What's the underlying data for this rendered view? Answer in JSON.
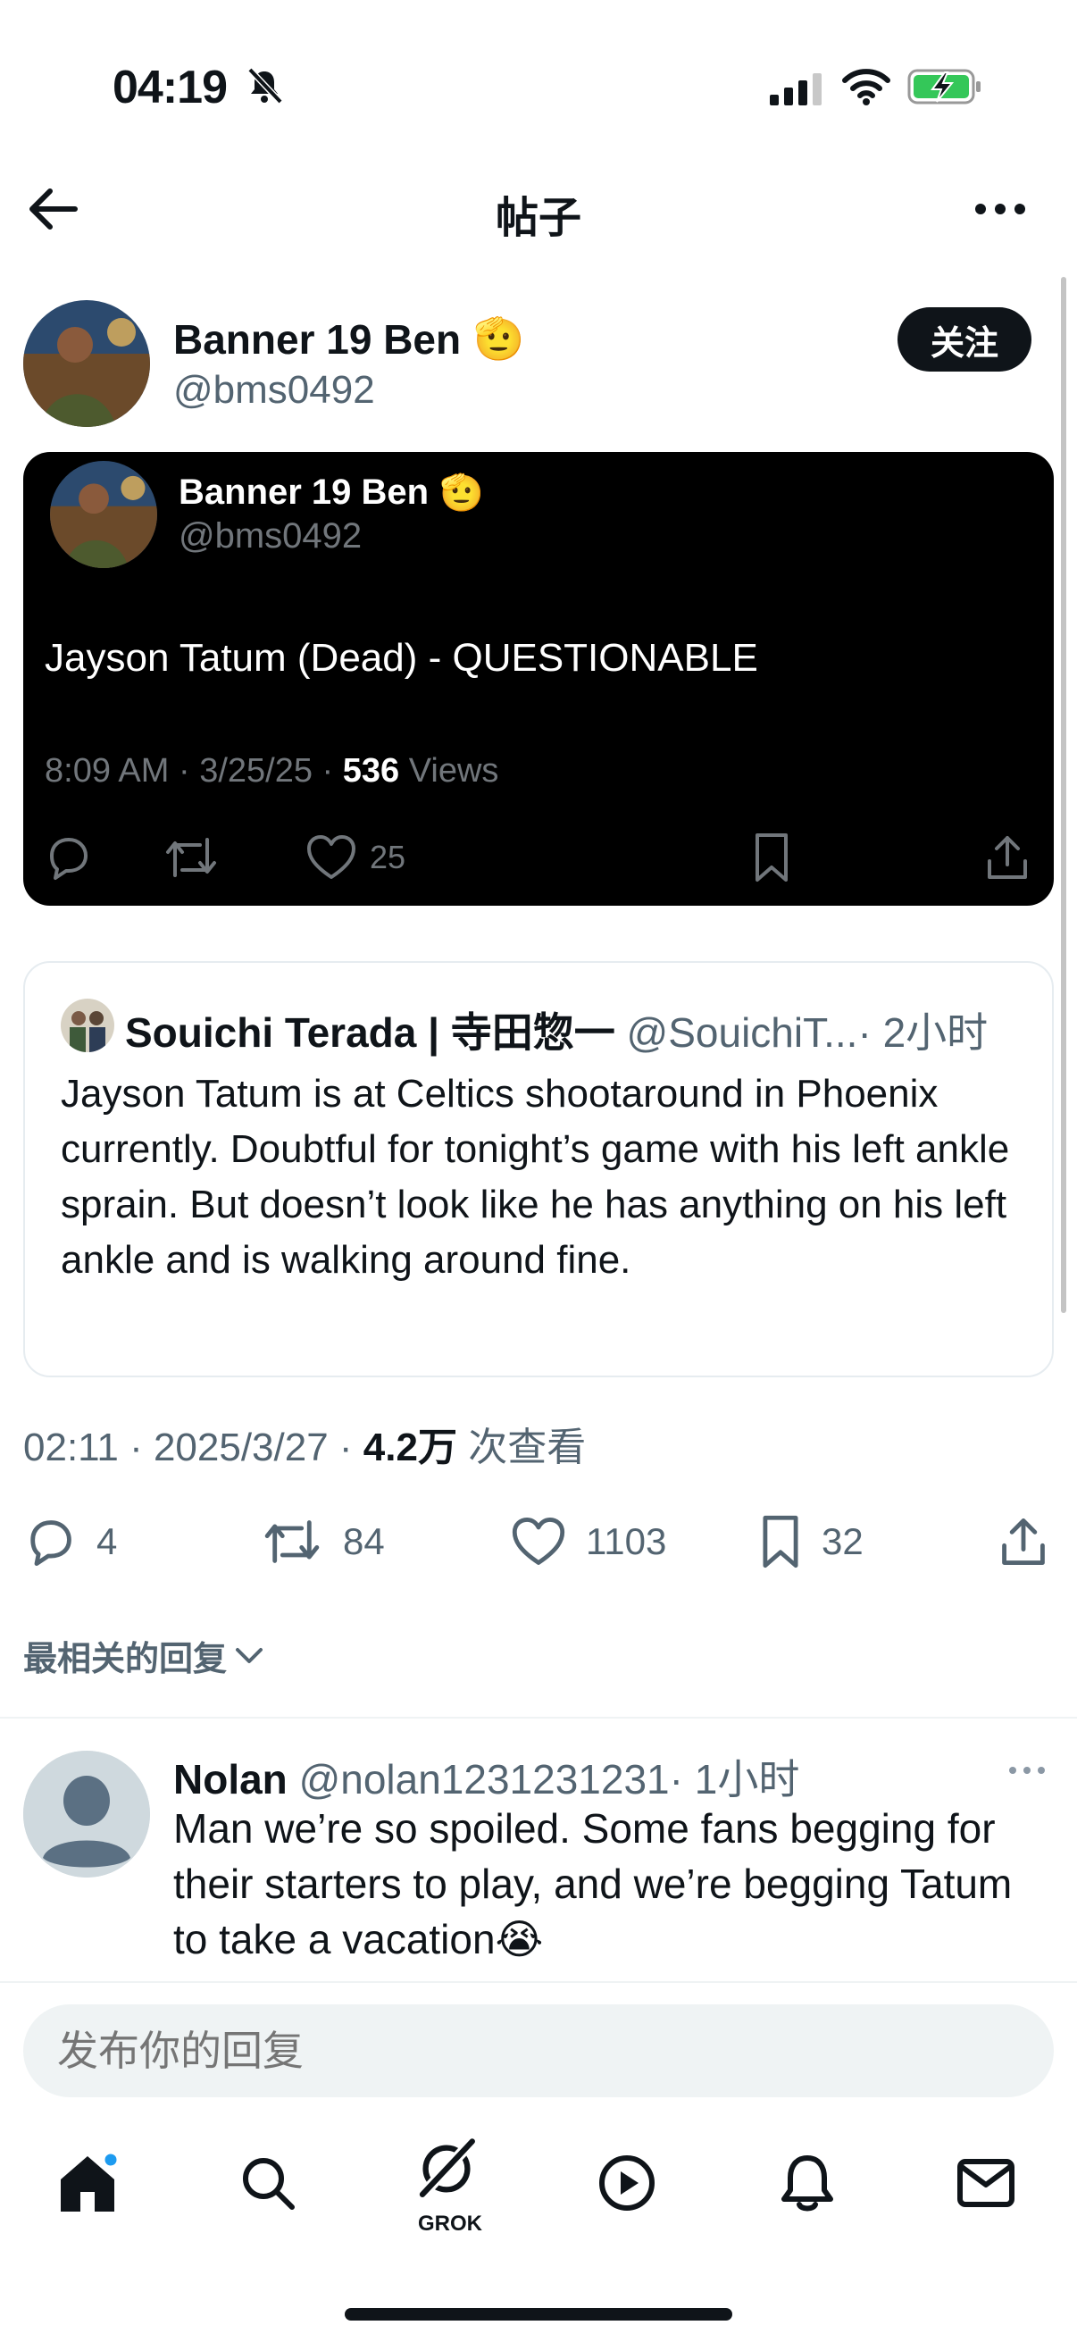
{
  "status_bar": {
    "time": "04:19"
  },
  "header": {
    "title": "帖子"
  },
  "post": {
    "author_name": "Banner 19 Ben",
    "author_handle": "@bms0492",
    "follow_label": "关注",
    "embedded": {
      "author_name": "Banner 19 Ben",
      "author_handle": "@bms0492",
      "text": "Jayson Tatum (Dead) - QUESTIONABLE",
      "time_date": "8:09 AM · 3/25/25 · ",
      "views_count": "536",
      "views_label": " Views",
      "likes": "25"
    },
    "quoted": {
      "author_name": "Souichi Terada | 寺田惣一",
      "author_handle": "@SouichiT...",
      "time": "· 2小时",
      "text": "Jayson Tatum is at Celtics shootaround in Phoenix currently. Doubtful for tonight’s game with his left ankle sprain. But doesn’t look like he has anything on his left ankle and is walking around fine."
    },
    "meta": {
      "time_date": "02:11 · 2025/3/27 · ",
      "views_count": "4.2万",
      "views_label": " 次查看"
    },
    "stats": {
      "replies": "4",
      "reposts": "84",
      "likes": "1103",
      "bookmarks": "32"
    }
  },
  "replies_sort": "最相关的回复",
  "reply": {
    "author_name": "Nolan",
    "author_handle": "@nolan1231231231",
    "time": "· 1小时",
    "text": "Man we’re so spoiled. Some fans begging for their starters to play, and we’re begging Tatum to take a vacation😭"
  },
  "reply_box": {
    "placeholder": "发布你的回复"
  },
  "tab_bar": {
    "grok_label": "GROK"
  },
  "colors": {
    "accent": "#1d9bf0",
    "text": "#0f1419",
    "secondary": "#536471",
    "battery": "#34c759"
  }
}
